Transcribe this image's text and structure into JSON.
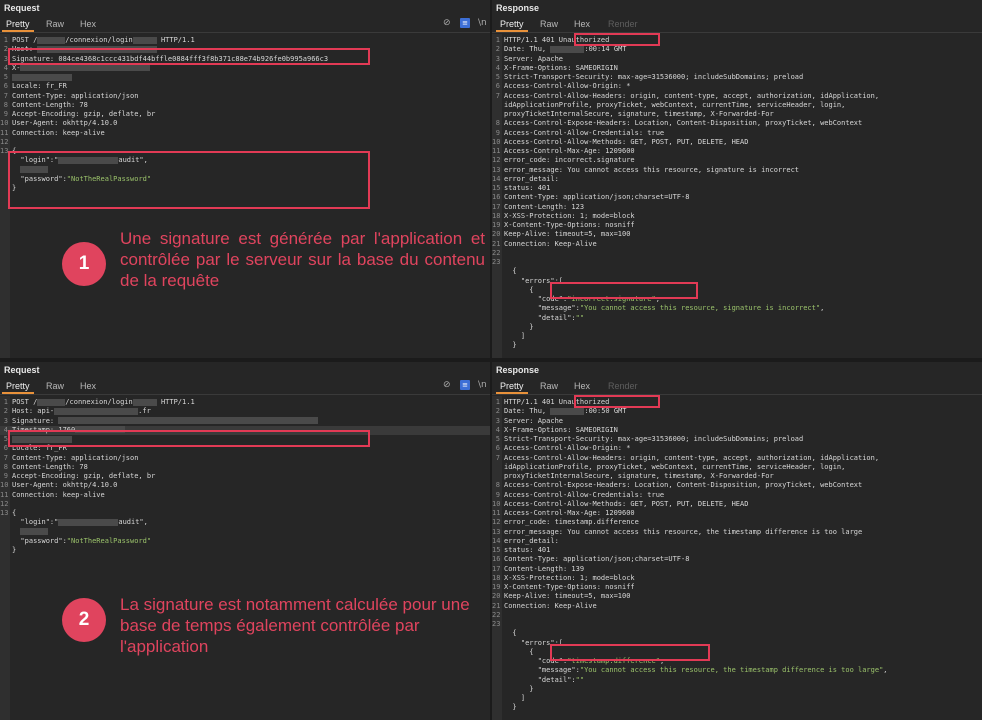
{
  "tabs_request": [
    "Pretty",
    "Raw",
    "Hex"
  ],
  "tabs_response": [
    "Pretty",
    "Raw",
    "Hex",
    "Render"
  ],
  "toolbar": {
    "ln_label": "\\n",
    "menu_label": "≡"
  },
  "top": {
    "request": {
      "title": "Request",
      "lines": [
        {
          "n": "1",
          "parts": [
            {
              "t": "POST /"
            },
            {
              "r": 28
            },
            {
              "t": "/connexion/login"
            },
            {
              "r": 24
            },
            {
              "t": " HTTP/1.1"
            }
          ]
        },
        {
          "n": "2",
          "parts": [
            {
              "t": "Host: "
            },
            {
              "r": 120
            }
          ]
        },
        {
          "n": "3",
          "parts": [
            {
              "t": "Signature: 084ce4368c1ccc431bdf44bffle0884fff3f8b371c88e74b926fe0b995a966c3"
            }
          ]
        },
        {
          "n": "4",
          "parts": [
            {
              "t": "X-"
            },
            {
              "r": 130
            }
          ]
        },
        {
          "n": "5",
          "parts": [
            {
              "r": 60
            }
          ]
        },
        {
          "n": "6",
          "parts": [
            {
              "t": "Locale: fr_FR"
            }
          ]
        },
        {
          "n": "7",
          "parts": [
            {
              "t": "Content-Type: application/json"
            }
          ]
        },
        {
          "n": "8",
          "parts": [
            {
              "t": "Content-Length: 78"
            }
          ]
        },
        {
          "n": "9",
          "parts": [
            {
              "t": "Accept-Encoding: gzip, deflate, br"
            }
          ]
        },
        {
          "n": "10",
          "parts": [
            {
              "t": "User-Agent: okhttp/4.10.0"
            }
          ]
        },
        {
          "n": "11",
          "parts": [
            {
              "t": "Connection: keep-alive"
            }
          ]
        },
        {
          "n": "12",
          "parts": [
            {
              "t": ""
            }
          ]
        },
        {
          "n": "13",
          "parts": [
            {
              "t": "{"
            }
          ]
        },
        {
          "n": "",
          "parts": [
            {
              "t": "  \"login\":\""
            },
            {
              "r": 60
            },
            {
              "t": "audit\","
            }
          ]
        },
        {
          "n": "",
          "parts": [
            {
              "t": "  "
            },
            {
              "r": 28
            }
          ]
        },
        {
          "n": "",
          "parts": [
            {
              "t": "  \"password\":"
            },
            {
              "s": "\"NotTheRealPassword\""
            }
          ]
        },
        {
          "n": "",
          "parts": [
            {
              "t": "}"
            }
          ]
        }
      ]
    },
    "response": {
      "title": "Response",
      "lines": [
        {
          "n": "1",
          "parts": [
            {
              "t": "HTTP/1.1 401 Unauthorized"
            }
          ]
        },
        {
          "n": "2",
          "parts": [
            {
              "t": "Date: Thu, "
            },
            {
              "r": 34
            },
            {
              "t": ":00:14 GMT"
            }
          ]
        },
        {
          "n": "3",
          "parts": [
            {
              "t": "Server: Apache"
            }
          ]
        },
        {
          "n": "4",
          "parts": [
            {
              "t": "X-Frame-Options: SAMEORIGIN"
            }
          ]
        },
        {
          "n": "5",
          "parts": [
            {
              "t": "Strict-Transport-Security: max-age=31536000; includeSubDomains; preload"
            }
          ]
        },
        {
          "n": "6",
          "parts": [
            {
              "t": "Access-Control-Allow-Origin: *"
            }
          ]
        },
        {
          "n": "7",
          "parts": [
            {
              "t": "Access-Control-Allow-Headers: origin, content-type, accept, authorization, idApplication,"
            }
          ]
        },
        {
          "n": "",
          "parts": [
            {
              "t": "idApplicationProfile, proxyTicket, webContext, currentTime, serviceHeader, login,"
            }
          ]
        },
        {
          "n": "",
          "parts": [
            {
              "t": "proxyTicketInternalSecure, signature, timestamp, X-Forwarded-For"
            }
          ]
        },
        {
          "n": "8",
          "parts": [
            {
              "t": "Access-Control-Expose-Headers: Location, Content-Disposition, proxyTicket, webContext"
            }
          ]
        },
        {
          "n": "9",
          "parts": [
            {
              "t": "Access-Control-Allow-Credentials: true"
            }
          ]
        },
        {
          "n": "10",
          "parts": [
            {
              "t": "Access-Control-Allow-Methods: GET, POST, PUT, DELETE, HEAD"
            }
          ]
        },
        {
          "n": "11",
          "parts": [
            {
              "t": "Access-Control-Max-Age: 1209600"
            }
          ]
        },
        {
          "n": "12",
          "parts": [
            {
              "t": "error_code: incorrect.signature"
            }
          ]
        },
        {
          "n": "13",
          "parts": [
            {
              "t": "error_message: You cannot access this resource, signature is incorrect"
            }
          ]
        },
        {
          "n": "14",
          "parts": [
            {
              "t": "error_detail:"
            }
          ]
        },
        {
          "n": "15",
          "parts": [
            {
              "t": "status: 401"
            }
          ]
        },
        {
          "n": "16",
          "parts": [
            {
              "t": "Content-Type: application/json;charset=UTF-8"
            }
          ]
        },
        {
          "n": "17",
          "parts": [
            {
              "t": "Content-Length: 123"
            }
          ]
        },
        {
          "n": "18",
          "parts": [
            {
              "t": "X-XSS-Protection: 1; mode=block"
            }
          ]
        },
        {
          "n": "19",
          "parts": [
            {
              "t": "X-Content-Type-Options: nosniff"
            }
          ]
        },
        {
          "n": "20",
          "parts": [
            {
              "t": "Keep-Alive: timeout=5, max=100"
            }
          ]
        },
        {
          "n": "21",
          "parts": [
            {
              "t": "Connection: Keep-Alive"
            }
          ]
        },
        {
          "n": "22",
          "parts": [
            {
              "t": ""
            }
          ]
        },
        {
          "n": "23",
          "parts": [
            {
              "t": ""
            }
          ]
        },
        {
          "n": "",
          "parts": [
            {
              "t": "  {"
            }
          ]
        },
        {
          "n": "",
          "parts": [
            {
              "t": "    \"errors\":["
            }
          ]
        },
        {
          "n": "",
          "parts": [
            {
              "t": "      {"
            }
          ]
        },
        {
          "n": "",
          "parts": [
            {
              "t": "        \"code\":"
            },
            {
              "s": "\"incorrect.signature\""
            },
            {
              "t": ","
            }
          ]
        },
        {
          "n": "",
          "parts": [
            {
              "t": "        \"message\":"
            },
            {
              "s": "\"You cannot access this resource, signature is incorrect\""
            },
            {
              "t": ","
            }
          ]
        },
        {
          "n": "",
          "parts": [
            {
              "t": "        \"detail\":"
            },
            {
              "s": "\"\""
            }
          ]
        },
        {
          "n": "",
          "parts": [
            {
              "t": "      }"
            }
          ]
        },
        {
          "n": "",
          "parts": [
            {
              "t": "    ]"
            }
          ]
        },
        {
          "n": "",
          "parts": [
            {
              "t": "  }"
            }
          ]
        }
      ]
    },
    "callout": {
      "number": "1",
      "text": "Une signature est générée par l'application et contrôlée par le serveur sur la base du contenu de la requête"
    }
  },
  "bottom": {
    "request": {
      "title": "Request",
      "lines": [
        {
          "n": "1",
          "parts": [
            {
              "t": "POST /"
            },
            {
              "r": 28
            },
            {
              "t": "/connexion/login"
            },
            {
              "r": 24
            },
            {
              "t": " HTTP/1.1"
            }
          ]
        },
        {
          "n": "2",
          "parts": [
            {
              "t": "Host: api-"
            },
            {
              "r": 84
            },
            {
              "t": ".fr"
            }
          ]
        },
        {
          "n": "3",
          "parts": [
            {
              "t": "Signature: "
            },
            {
              "r": 260
            }
          ]
        },
        {
          "n": "4",
          "parts": [
            {
              "t": "Timestamp: 1760"
            },
            {
              "r": 50
            }
          ]
        },
        {
          "n": "5",
          "parts": [
            {
              "r": 60
            }
          ]
        },
        {
          "n": "6",
          "parts": [
            {
              "t": "Locale: fr_FR"
            }
          ]
        },
        {
          "n": "7",
          "parts": [
            {
              "t": "Content-Type: application/json"
            }
          ]
        },
        {
          "n": "8",
          "parts": [
            {
              "t": "Content-Length: 78"
            }
          ]
        },
        {
          "n": "9",
          "parts": [
            {
              "t": "Accept-Encoding: gzip, deflate, br"
            }
          ]
        },
        {
          "n": "10",
          "parts": [
            {
              "t": "User-Agent: okhttp/4.10.0"
            }
          ]
        },
        {
          "n": "11",
          "parts": [
            {
              "t": "Connection: keep-alive"
            }
          ]
        },
        {
          "n": "12",
          "parts": [
            {
              "t": ""
            }
          ]
        },
        {
          "n": "13",
          "parts": [
            {
              "t": "{"
            }
          ]
        },
        {
          "n": "",
          "parts": [
            {
              "t": "  \"login\":\""
            },
            {
              "r": 60
            },
            {
              "t": "audit\","
            }
          ]
        },
        {
          "n": "",
          "parts": [
            {
              "t": "  "
            },
            {
              "r": 28
            }
          ]
        },
        {
          "n": "",
          "parts": [
            {
              "t": "  \"password\":"
            },
            {
              "s": "\"NotTheRealPassword\""
            }
          ]
        },
        {
          "n": "",
          "parts": [
            {
              "t": "}"
            }
          ]
        }
      ]
    },
    "response": {
      "title": "Response",
      "lines": [
        {
          "n": "1",
          "parts": [
            {
              "t": "HTTP/1.1 401 Unauthorized"
            }
          ]
        },
        {
          "n": "2",
          "parts": [
            {
              "t": "Date: Thu, "
            },
            {
              "r": 34
            },
            {
              "t": ":00:50 GMT"
            }
          ]
        },
        {
          "n": "3",
          "parts": [
            {
              "t": "Server: Apache"
            }
          ]
        },
        {
          "n": "4",
          "parts": [
            {
              "t": "X-Frame-Options: SAMEORIGIN"
            }
          ]
        },
        {
          "n": "5",
          "parts": [
            {
              "t": "Strict-Transport-Security: max-age=31536000; includeSubDomains; preload"
            }
          ]
        },
        {
          "n": "6",
          "parts": [
            {
              "t": "Access-Control-Allow-Origin: *"
            }
          ]
        },
        {
          "n": "7",
          "parts": [
            {
              "t": "Access-Control-Allow-Headers: origin, content-type, accept, authorization, idApplication,"
            }
          ]
        },
        {
          "n": "",
          "parts": [
            {
              "t": "idApplicationProfile, proxyTicket, webContext, currentTime, serviceHeader, login,"
            }
          ]
        },
        {
          "n": "",
          "parts": [
            {
              "t": "proxyTicketInternalSecure, signature, timestamp, X-Forwarded-For"
            }
          ]
        },
        {
          "n": "8",
          "parts": [
            {
              "t": "Access-Control-Expose-Headers: Location, Content-Disposition, proxyTicket, webContext"
            }
          ]
        },
        {
          "n": "9",
          "parts": [
            {
              "t": "Access-Control-Allow-Credentials: true"
            }
          ]
        },
        {
          "n": "10",
          "parts": [
            {
              "t": "Access-Control-Allow-Methods: GET, POST, PUT, DELETE, HEAD"
            }
          ]
        },
        {
          "n": "11",
          "parts": [
            {
              "t": "Access-Control-Max-Age: 1209600"
            }
          ]
        },
        {
          "n": "12",
          "parts": [
            {
              "t": "error_code: timestamp.difference"
            }
          ]
        },
        {
          "n": "13",
          "parts": [
            {
              "t": "error_message: You cannot access this resource, the timestamp difference is too large"
            }
          ]
        },
        {
          "n": "14",
          "parts": [
            {
              "t": "error_detail:"
            }
          ]
        },
        {
          "n": "15",
          "parts": [
            {
              "t": "status: 401"
            }
          ]
        },
        {
          "n": "16",
          "parts": [
            {
              "t": "Content-Type: application/json;charset=UTF-8"
            }
          ]
        },
        {
          "n": "17",
          "parts": [
            {
              "t": "Content-Length: 139"
            }
          ]
        },
        {
          "n": "18",
          "parts": [
            {
              "t": "X-XSS-Protection: 1; mode=block"
            }
          ]
        },
        {
          "n": "19",
          "parts": [
            {
              "t": "X-Content-Type-Options: nosniff"
            }
          ]
        },
        {
          "n": "20",
          "parts": [
            {
              "t": "Keep-Alive: timeout=5, max=100"
            }
          ]
        },
        {
          "n": "21",
          "parts": [
            {
              "t": "Connection: Keep-Alive"
            }
          ]
        },
        {
          "n": "22",
          "parts": [
            {
              "t": ""
            }
          ]
        },
        {
          "n": "23",
          "parts": [
            {
              "t": ""
            }
          ]
        },
        {
          "n": "",
          "parts": [
            {
              "t": "  {"
            }
          ]
        },
        {
          "n": "",
          "parts": [
            {
              "t": "    \"errors\":["
            }
          ]
        },
        {
          "n": "",
          "parts": [
            {
              "t": "      {"
            }
          ]
        },
        {
          "n": "",
          "parts": [
            {
              "t": "        \"code\":"
            },
            {
              "s": "\"timestamp.difference\""
            },
            {
              "t": ","
            }
          ]
        },
        {
          "n": "",
          "parts": [
            {
              "t": "        \"message\":"
            },
            {
              "s": "\"You cannot access this resource, the timestamp difference is too large\""
            },
            {
              "t": ","
            }
          ]
        },
        {
          "n": "",
          "parts": [
            {
              "t": "        \"detail\":"
            },
            {
              "s": "\"\""
            }
          ]
        },
        {
          "n": "",
          "parts": [
            {
              "t": "      }"
            }
          ]
        },
        {
          "n": "",
          "parts": [
            {
              "t": "    ]"
            }
          ]
        },
        {
          "n": "",
          "parts": [
            {
              "t": "  }"
            }
          ]
        }
      ]
    },
    "callout": {
      "number": "2",
      "text": "La signature est notamment calculée pour une base de temps également contrôlée par l'application"
    }
  },
  "colors": {
    "accent_red": "#e0445e",
    "tab_underline": "#e8913a",
    "string_green": "#9bc36b"
  }
}
